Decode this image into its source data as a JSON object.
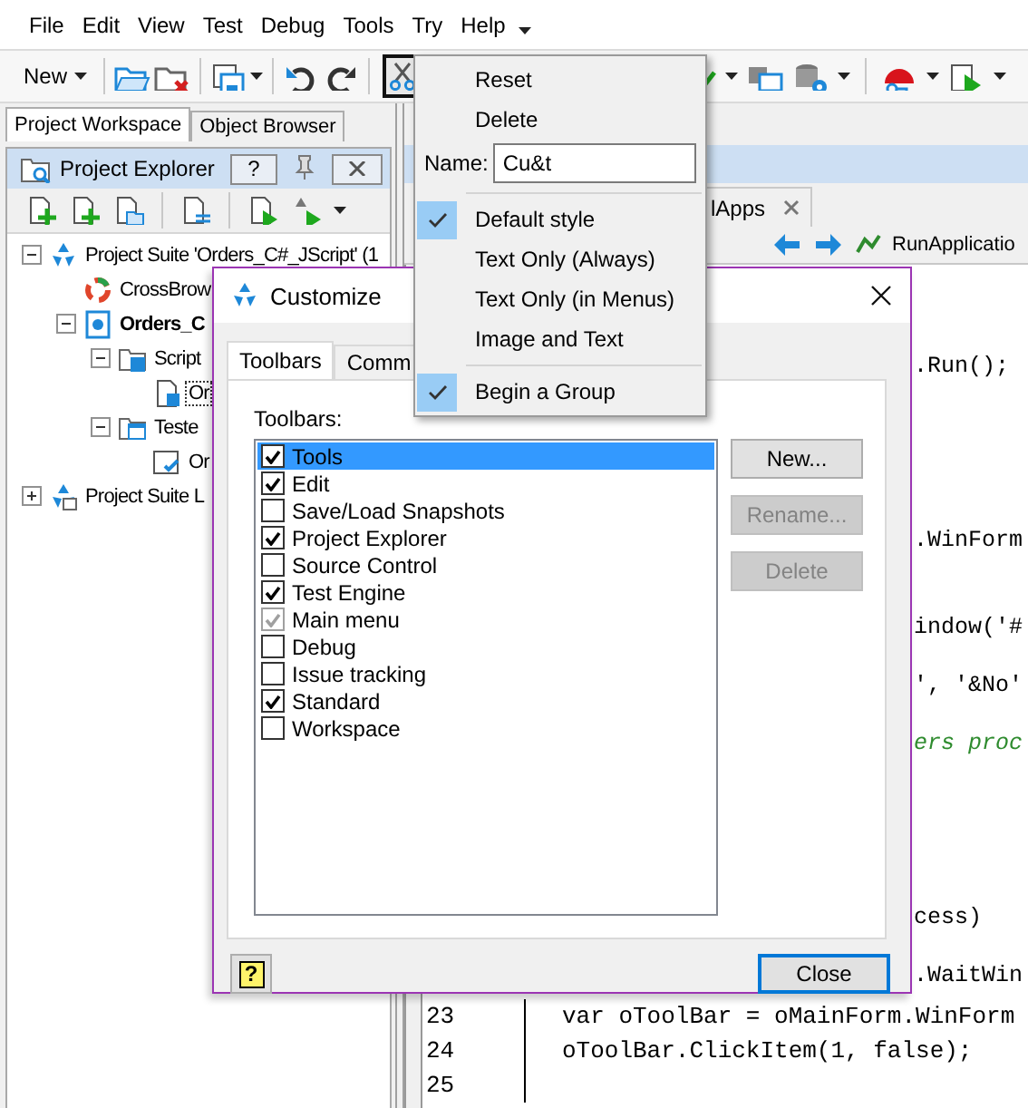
{
  "menu_bar": [
    "File",
    "Edit",
    "View",
    "Test",
    "Debug",
    "Tools",
    "Try",
    "Help"
  ],
  "toolbar": {
    "new_button": "New"
  },
  "left_panel": {
    "tabs": [
      {
        "label": "Project Workspace",
        "selected": true
      },
      {
        "label": "Object Browser",
        "selected": false
      }
    ],
    "explorer": {
      "title": "Project Explorer",
      "help_button": "?",
      "tree": [
        {
          "label": "Project Suite 'Orders_C#_JScript' (1",
          "kind": "suite",
          "expanded": true,
          "children": [
            {
              "label": "CrossBrow",
              "kind": "browser"
            },
            {
              "label": "Orders_C",
              "kind": "project",
              "expanded": true,
              "children": [
                {
                  "label": "Script",
                  "kind": "script-folder",
                  "expanded": true,
                  "children": [
                    {
                      "label": "Or",
                      "kind": "script",
                      "focused": true
                    }
                  ]
                },
                {
                  "label": "Teste",
                  "kind": "app-folder",
                  "expanded": true,
                  "children": [
                    {
                      "label": "Or",
                      "kind": "app",
                      "focused": false
                    }
                  ]
                }
              ]
            }
          ]
        },
        {
          "label": "Project Suite L",
          "kind": "suite-other",
          "expanded": false
        }
      ]
    }
  },
  "editor": {
    "tab": {
      "label": "lApps"
    },
    "routine": "RunApplicatio",
    "lines": [
      {
        "kind": "fragment",
        "text": ".Run();"
      },
      {
        "kind": "fragment",
        "text": ".WinForm"
      },
      {
        "kind": "fragment",
        "text": "indow('#"
      },
      {
        "kind": "fragment",
        "text": "', '&No'"
      },
      {
        "kind": "comment",
        "text": "ers proc"
      },
      {
        "kind": "fragment",
        "text": "cess)"
      },
      {
        "kind": "fragment",
        "text": ".WaitWin"
      },
      {
        "kind": "line",
        "number": "23",
        "text": "var oToolBar = oMainForm.WinForm"
      },
      {
        "kind": "line",
        "number": "24",
        "text": "oToolBar.ClickItem(1, false);"
      },
      {
        "kind": "line",
        "number": "25"
      }
    ]
  },
  "context_menu": {
    "items": [
      {
        "kind": "command",
        "label": "Reset",
        "checked": false,
        "separator_before": false
      },
      {
        "kind": "command",
        "label": "Delete",
        "checked": false,
        "separator_before": false
      },
      {
        "kind": "field",
        "label": "Name:",
        "value": "Cu&t",
        "separator_before": false
      },
      {
        "kind": "command",
        "label": "Default style",
        "checked": true,
        "separator_before": true
      },
      {
        "kind": "command",
        "label": "Text Only (Always)",
        "checked": false,
        "separator_before": false
      },
      {
        "kind": "command",
        "label": "Text Only (in Menus)",
        "checked": false,
        "separator_before": false
      },
      {
        "kind": "command",
        "label": "Image and Text",
        "checked": false,
        "separator_before": false
      },
      {
        "kind": "command",
        "label": "Begin a Group",
        "checked": true,
        "separator_before": true
      }
    ]
  },
  "dialog": {
    "title": "Customize",
    "tabs": [
      {
        "label": "Toolbars",
        "selected": true
      },
      {
        "label": "Comm",
        "selected": false
      }
    ],
    "list_label": "Toolbars:",
    "toolbars": [
      {
        "label": "Tools",
        "checked": true,
        "disabled": false,
        "selected": true
      },
      {
        "label": "Edit",
        "checked": true,
        "disabled": false,
        "selected": false
      },
      {
        "label": "Save/Load Snapshots",
        "checked": false,
        "disabled": false,
        "selected": false
      },
      {
        "label": "Project Explorer",
        "checked": true,
        "disabled": false,
        "selected": false
      },
      {
        "label": "Source Control",
        "checked": false,
        "disabled": false,
        "selected": false
      },
      {
        "label": "Test Engine",
        "checked": true,
        "disabled": false,
        "selected": false
      },
      {
        "label": "Main menu",
        "checked": true,
        "disabled": true,
        "selected": false
      },
      {
        "label": "Debug",
        "checked": false,
        "disabled": false,
        "selected": false
      },
      {
        "label": "Issue tracking",
        "checked": false,
        "disabled": false,
        "selected": false
      },
      {
        "label": "Standard",
        "checked": true,
        "disabled": false,
        "selected": false
      },
      {
        "label": "Workspace",
        "checked": false,
        "disabled": false,
        "selected": false
      }
    ],
    "buttons": [
      {
        "label": "New...",
        "disabled": false
      },
      {
        "label": "Rename...",
        "disabled": true
      },
      {
        "label": "Delete",
        "disabled": true
      }
    ],
    "help_button": "?",
    "close_button": {
      "label": "Close",
      "focused": true
    }
  }
}
